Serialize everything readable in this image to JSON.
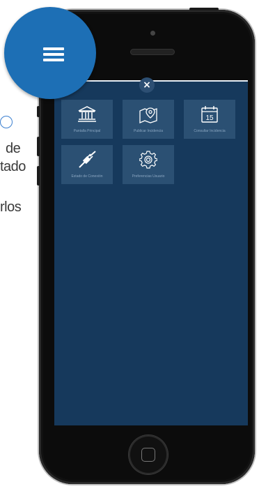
{
  "background_text": {
    "line1": "de",
    "line2": "tado",
    "line3": "rlos"
  },
  "menu": {
    "close_label": "×",
    "tiles": [
      {
        "label": "Pantalla Principal",
        "icon": "bank-building-icon"
      },
      {
        "label": "Publicar Incidencia",
        "icon": "map-pin-icon"
      },
      {
        "label": "Consultar Incidencia",
        "icon": "calendar-icon",
        "date": "15"
      },
      {
        "label": "Estado de Conexión",
        "icon": "plug-icon"
      },
      {
        "label": "Preferencias Usuario",
        "icon": "gear-icon"
      }
    ]
  },
  "colors": {
    "menu_button": "#1d6fb5",
    "screen_bg": "#16395c",
    "tile_bg": "#2b5073",
    "tile_label": "#8aa6c1"
  }
}
